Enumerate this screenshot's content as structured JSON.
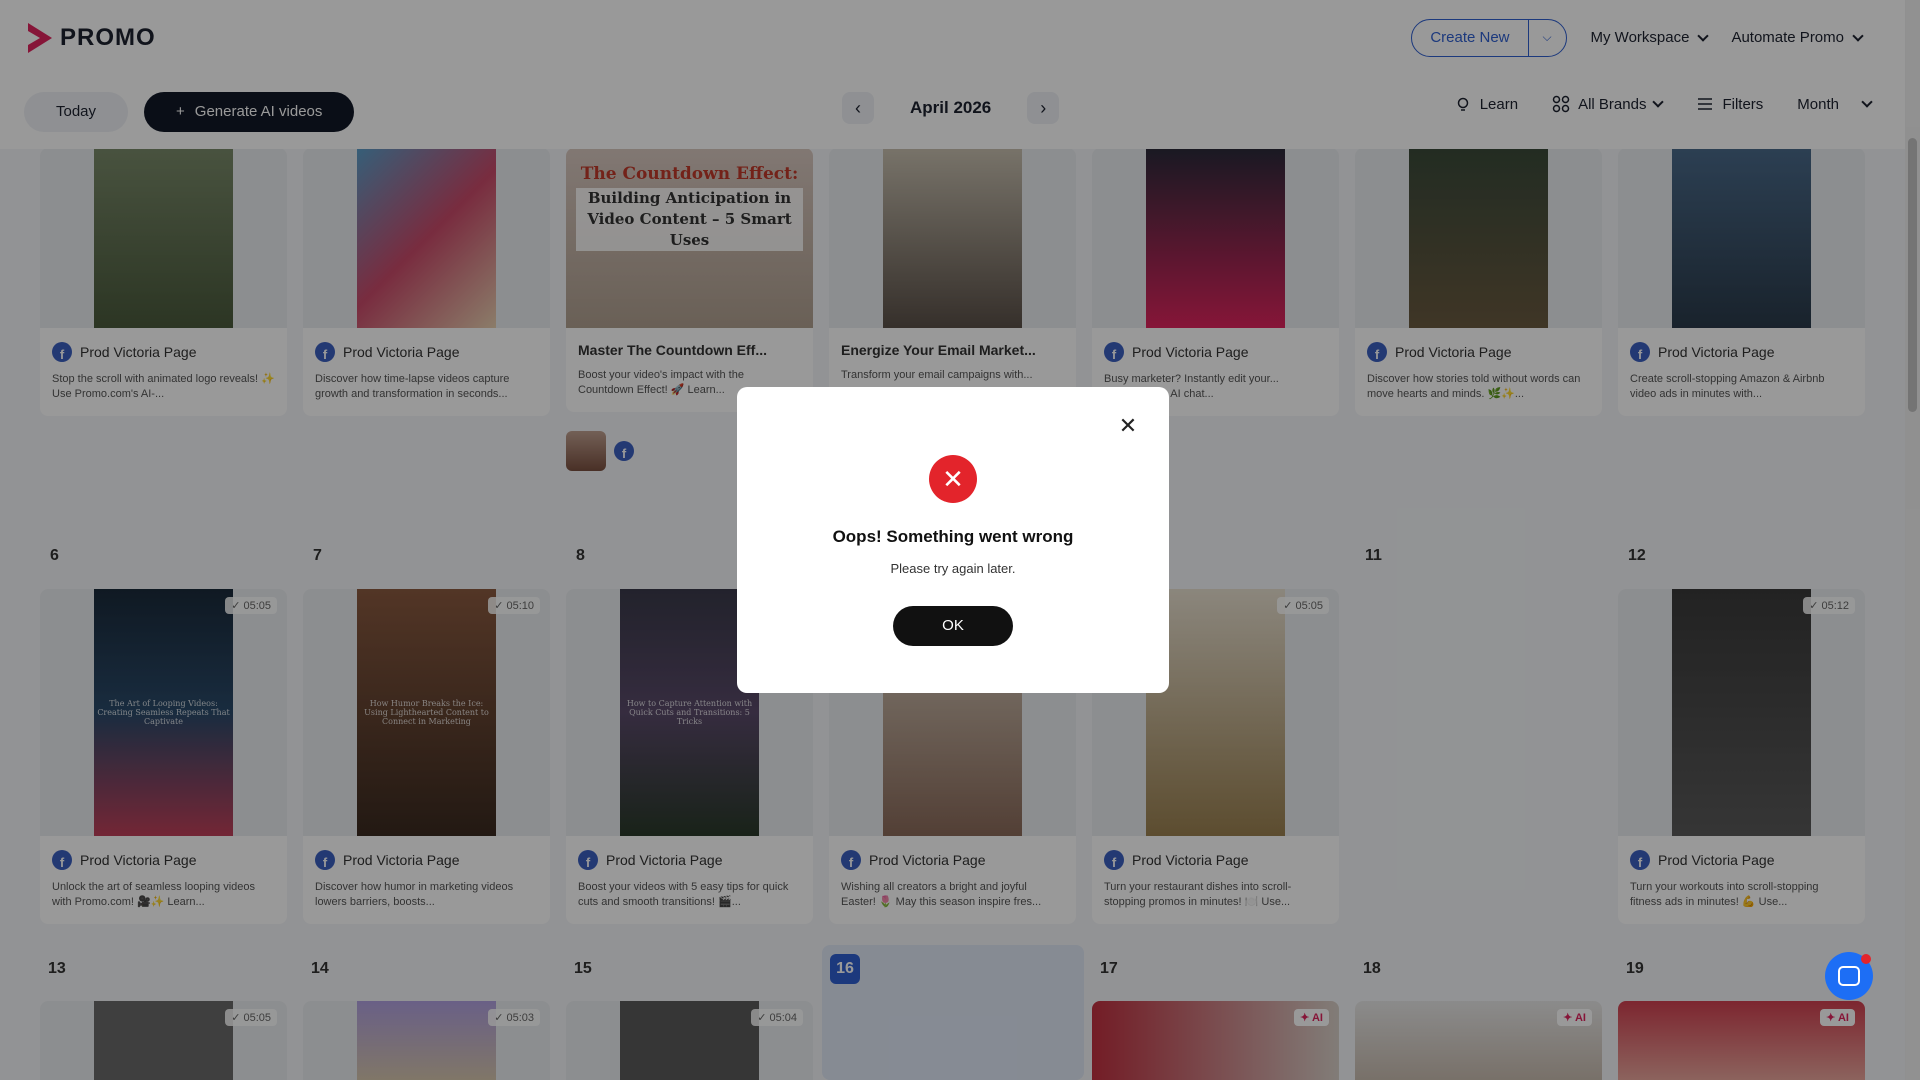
{
  "header": {
    "brand": "PROMO",
    "create_new": "Create New",
    "workspace": "My Workspace",
    "automate": "Automate Promo"
  },
  "toolbar": {
    "today": "Today",
    "generate": "Generate AI videos",
    "month": "April 2026",
    "learn": "Learn",
    "brands": "All Brands",
    "filters": "Filters",
    "view": "Month"
  },
  "week1": [
    {
      "page": "Prod Victoria Page",
      "desc": "Stop the scroll with animated logo reveals! ✨ Use Promo.com's AI-..."
    },
    {
      "page": "Prod Victoria Page",
      "desc": "Discover how time-lapse videos capture growth and transformation in seconds..."
    },
    {
      "title": "Master The Countdown Eff...",
      "desc": "Boost your video's impact with the Countdown Effect! 🚀 Learn..."
    },
    {
      "title": "Energize Your Email Market...",
      "desc": "Transform your email campaigns with..."
    },
    {
      "page": "Prod Victoria Page",
      "desc": "Busy marketer? Instantly edit your... Promo.com's AI chat..."
    },
    {
      "page": "Prod Victoria Page",
      "desc": "Discover how stories told without words can move hearts and minds. 🌿✨..."
    },
    {
      "page": "Prod Victoria Page",
      "desc": "Create scroll-stopping Amazon & Airbnb video ads in minutes with..."
    }
  ],
  "countdown_thumb": {
    "line1": "The Countdown Effect:",
    "line2": "Building Anticipation in Video Content – 5 Smart Uses"
  },
  "week2_days": [
    "6",
    "7",
    "8",
    "11",
    "12"
  ],
  "week2": [
    {
      "page": "Prod Victoria Page",
      "time": "05:05",
      "overlay": "The Art of Looping Videos: Creating Seamless Repeats That Captivate",
      "desc": "Unlock the art of seamless looping videos with Promo.com! 🎥✨ Learn..."
    },
    {
      "page": "Prod Victoria Page",
      "time": "05:10",
      "overlay": "How Humor Breaks the Ice: Using Lighthearted Content to Connect in Marketing",
      "desc": "Discover how humor in marketing videos lowers barriers, boosts..."
    },
    {
      "page": "Prod Victoria Page",
      "time": "",
      "overlay": "How to Capture Attention with Quick Cuts and Transitions: 5 Tricks",
      "desc": "Boost your videos with 5 easy tips for quick cuts and smooth transitions! 🎬..."
    },
    {
      "page": "Prod Victoria Page",
      "time": "",
      "overlay": "",
      "desc": "Wishing all creators a bright and joyful Easter! 🌷 May this season inspire fres..."
    },
    {
      "page": "Prod Victoria Page",
      "time": "05:05",
      "overlay": "",
      "desc": "Turn your restaurant dishes into scroll-stopping promos in minutes! 🍽️ Use..."
    },
    {
      "page": "Prod Victoria Page",
      "time": "05:12",
      "overlay": "",
      "desc": "Turn your workouts into scroll-stopping fitness ads in minutes! 💪 Use..."
    }
  ],
  "week3_days": [
    "13",
    "14",
    "15",
    "16",
    "17",
    "18",
    "19"
  ],
  "week3_badges": [
    "05:05",
    "05:03",
    "05:04",
    "AI",
    "AI",
    "AI"
  ],
  "modal": {
    "title": "Oops! Something went wrong",
    "subtitle": "Please try again later.",
    "ok": "OK"
  },
  "colors": {
    "accent": "#2f5fd0",
    "error": "#e3242b",
    "dark_button": "#111827"
  }
}
